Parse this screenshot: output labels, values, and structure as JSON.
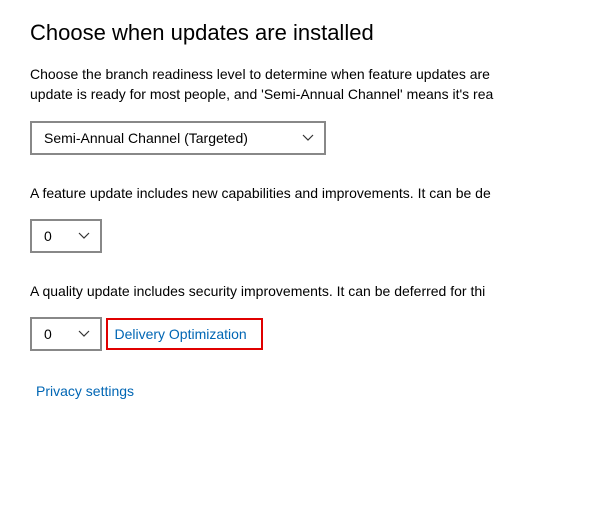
{
  "heading": "Choose when updates are installed",
  "intro_line1": "Choose the branch readiness level to determine when feature updates are ",
  "intro_line2": "update is ready for most people, and 'Semi-Annual Channel' means it's rea",
  "branch_dropdown": {
    "selected": "Semi-Annual Channel (Targeted)"
  },
  "feature_text": "A feature update includes new capabilities and improvements. It can be de",
  "feature_dropdown": {
    "selected": "0"
  },
  "quality_text": "A quality update includes security improvements. It can be deferred for thi",
  "quality_dropdown": {
    "selected": "0"
  },
  "links": {
    "delivery": "Delivery Optimization",
    "privacy": "Privacy settings"
  }
}
